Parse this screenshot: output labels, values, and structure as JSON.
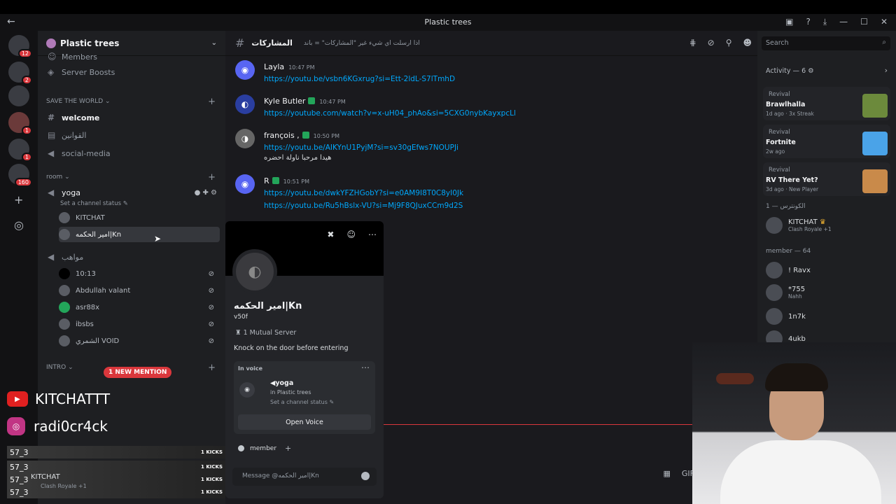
{
  "window": {
    "title": "Plastic trees"
  },
  "servers": [
    {
      "badge": "12"
    },
    {
      "badge": "2"
    },
    {
      "badge": ""
    },
    {
      "badge": "1"
    },
    {
      "badge": "1"
    },
    {
      "badge": "160"
    }
  ],
  "sidebar": {
    "guild_name": "Plastic trees",
    "top_items": [
      {
        "label": "Members"
      },
      {
        "label": "Server Boosts"
      }
    ],
    "categories": {
      "save": "SAVE THE WORLD",
      "room": "room",
      "intro": "INTRO"
    },
    "channels": [
      {
        "label": "welcome"
      },
      {
        "label": "القوانين"
      },
      {
        "label": "social-media"
      }
    ],
    "voice_channel": {
      "name": "yoga",
      "status": "Set a channel status"
    },
    "voice_users": [
      {
        "name": "KITCHAT"
      },
      {
        "name": "امير الحكمه|Kn"
      }
    ],
    "voice_channel2": {
      "name": "مواهب"
    },
    "voice_users2": [
      {
        "name": "10:13"
      },
      {
        "name": "Abdullah valant"
      },
      {
        "name": "asr88x"
      },
      {
        "name": "ibsbs"
      },
      {
        "name": "الشمري VOID"
      }
    ],
    "mention_pill": "1 NEW MENTION"
  },
  "overlay": {
    "youtube": "KITCHATTT",
    "instagram": "radi0cr4ck",
    "kick_rows": [
      {
        "name": "57_3",
        "kicks": "1 KICKS"
      },
      {
        "name": "57_3",
        "kicks": "1 KICKS"
      },
      {
        "name": "57_3",
        "kicks": "1 KICKS"
      },
      {
        "name": "57_3",
        "kicks": "1 KICKS"
      }
    ],
    "userbar_name": "KITCHAT",
    "userbar_sub": "Clash Royale +1"
  },
  "chat": {
    "channel": "المشاركات",
    "topic": "اذا ارسلت اي شيء غير \"المشاركات\" = باند",
    "messages": [
      {
        "author": "Layla",
        "time": "10:47 PM",
        "lines": [
          "https://youtu.be/vsbn6KGxrug?si=Ett-2ldL-S7lTmhD"
        ]
      },
      {
        "author": "Kyle Butler",
        "time": "10:47 PM",
        "lines": [
          "https://youtube.com/watch?v=x-uH04_phAo&si=5CXG0nybKayxpcLl"
        ]
      },
      {
        "author": "françois ,",
        "time": "10:50 PM",
        "lines": [
          "https://youtu.be/AIKYnU1PyjM?si=sv30gEfws7NOUPJi"
        ],
        "text": "هيدا مرحبا ناولة احضره"
      },
      {
        "author": "R",
        "time": "10:51 PM",
        "lines": [
          "https://youtu.be/dwkYFZHGobY?si=e0AM9I8T0C8yI0Jk",
          "https://youtu.be/Ru5hBslx-VU?si=Mj9F8QJuxCCm9d2S"
        ]
      }
    ],
    "search_placeholder": "Search"
  },
  "profile": {
    "name": "امير الحكمه|Kn",
    "tag": "v50f",
    "mutual": "1 Mutual Server",
    "bio": "Knock on the door before entering",
    "in_voice_label": "In voice",
    "voice_channel": "yoga",
    "voice_server": "in Plastic trees",
    "voice_status": "Set a channel status",
    "open_voice": "Open Voice",
    "role": "member",
    "dm_placeholder": "Message @امير الحكمه|Kn"
  },
  "activity": {
    "title": "Activity — 6",
    "cards": [
      {
        "label": "Revival",
        "game": "Brawlhalla",
        "meta": "1d ago · 3x Streak",
        "color": "#6c8a3c"
      },
      {
        "label": "Revival",
        "game": "Fortnite",
        "meta": "2w ago",
        "color": "#4aa3e8"
      },
      {
        "label": "Revival",
        "game": "RV There Yet?",
        "meta": "3d ago · New Player",
        "color": "#c98a4a"
      }
    ],
    "owner_section": "الكونترس — 1",
    "owner": {
      "name": "KITCHAT",
      "sub": "Clash Royale +1"
    },
    "member_section": "member — 64",
    "members": [
      {
        "name": "! Ravx",
        "sub": ""
      },
      {
        "name": "*755",
        "sub": "Nahh"
      },
      {
        "name": "1n7k",
        "sub": ""
      },
      {
        "name": "4ukb",
        "sub": ""
      }
    ]
  }
}
